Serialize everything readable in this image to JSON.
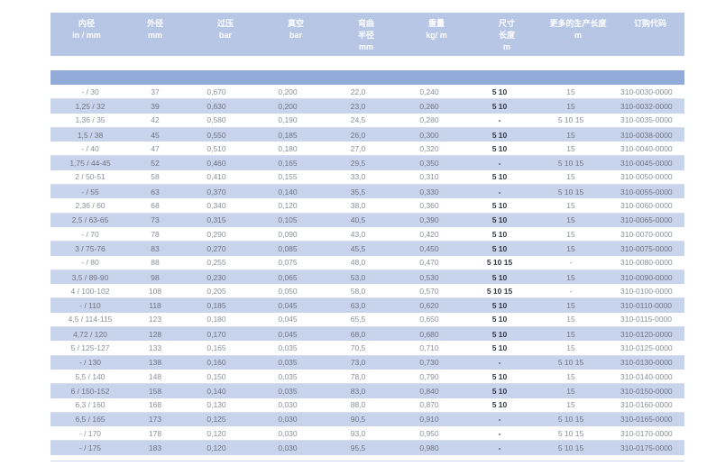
{
  "headers": [
    {
      "l1": "内径",
      "l2": "in / mm",
      "l3": ""
    },
    {
      "l1": "外径",
      "l2": "mm",
      "l3": ""
    },
    {
      "l1": "过压",
      "l2": "bar",
      "l3": ""
    },
    {
      "l1": "真空",
      "l2": "bar",
      "l3": ""
    },
    {
      "l1": "弯曲",
      "l2": "半径",
      "l3": "mm"
    },
    {
      "l1": "重量",
      "l2": "kg/ m",
      "l3": ""
    },
    {
      "l1": "尺寸",
      "l2": "长度",
      "l3": "m"
    },
    {
      "l1": "更多的生产长度",
      "l2": "m",
      "l3": ""
    },
    {
      "l1": "订购代码",
      "l2": "",
      "l3": ""
    }
  ],
  "rows": [
    [
      "- / 30",
      "37",
      "0,670",
      "0,200",
      "22,0",
      "0,240",
      "5 10",
      "15",
      "310-0030-0000"
    ],
    [
      "1,25 / 32",
      "39",
      "0,630",
      "0,200",
      "23,0",
      "0,260",
      "5 10",
      "15",
      "310-0032-0000"
    ],
    [
      "1,36 / 35",
      "42",
      "0,580",
      "0,190",
      "24,5",
      "0,280",
      "-",
      "5 10 15",
      "310-0035-0000"
    ],
    [
      "1,5 / 38",
      "45",
      "0,550",
      "0,185",
      "26,0",
      "0,300",
      "5 10",
      "15",
      "310-0038-0000"
    ],
    [
      "- / 40",
      "47",
      "0,510",
      "0,180",
      "27,0",
      "0,320",
      "5 10",
      "15",
      "310-0040-0000"
    ],
    [
      "1,75 / 44-45",
      "52",
      "0,460",
      "0,165",
      "29,5",
      "0,350",
      "-",
      "5 10 15",
      "310-0045-0000"
    ],
    [
      "2 / 50-51",
      "58",
      "0,410",
      "0,155",
      "33,0",
      "0,310",
      "5 10",
      "15",
      "310-0050-0000"
    ],
    [
      "- / 55",
      "63",
      "0,370",
      "0,140",
      "35,5",
      "0,330",
      "-",
      "5 10 15",
      "310-0055-0000"
    ],
    [
      "2,36 / 60",
      "68",
      "0,340",
      "0,120",
      "38,0",
      "0,360",
      "5 10",
      "15",
      "310-0060-0000"
    ],
    [
      "2,5 / 63-65",
      "73",
      "0,315",
      "0,105",
      "40,5",
      "0,390",
      "5 10",
      "15",
      "310-0065-0000"
    ],
    [
      "- / 70",
      "78",
      "0,290",
      "0,090",
      "43,0",
      "0,420",
      "5 10",
      "15",
      "310-0070-0000"
    ],
    [
      "3 / 75-76",
      "83",
      "0,270",
      "0,085",
      "45,5",
      "0,450",
      "5 10",
      "15",
      "310-0075-0000"
    ],
    [
      "- / 80",
      "88",
      "0,255",
      "0,075",
      "48,0",
      "0,470",
      "5 10 15",
      "-",
      "310-0080-0000"
    ],
    [
      "3,5 / 89-90",
      "98",
      "0,230",
      "0,065",
      "53,0",
      "0,530",
      "5 10",
      "15",
      "310-0090-0000"
    ],
    [
      "4 / 100-102",
      "108",
      "0,205",
      "0,050",
      "58,0",
      "0,570",
      "5 10 15",
      "-",
      "310-0100-0000"
    ],
    [
      "- / 110",
      "118",
      "0,185",
      "0,045",
      "63,0",
      "0,620",
      "5 10",
      "15",
      "310-0110-0000"
    ],
    [
      "4,5 / 114-115",
      "123",
      "0,180",
      "0,045",
      "65,5",
      "0,650",
      "5 10",
      "15",
      "310-0115-0000"
    ],
    [
      "4,72 / 120",
      "128",
      "0,170",
      "0,045",
      "68,0",
      "0,680",
      "5 10",
      "15",
      "310-0120-0000"
    ],
    [
      "5 / 125-127",
      "133",
      "0,165",
      "0,035",
      "70,5",
      "0,710",
      "5 10",
      "15",
      "310-0125-0000"
    ],
    [
      "- / 130",
      "138",
      "0,160",
      "0,035",
      "73,0",
      "0,730",
      "-",
      "5 10 15",
      "310-0130-0000"
    ],
    [
      "5,5 / 140",
      "148",
      "0,150",
      "0,035",
      "78,0",
      "0,790",
      "5 10",
      "15",
      "310-0140-0000"
    ],
    [
      "6 / 150-152",
      "158",
      "0,140",
      "0,035",
      "83,0",
      "0,840",
      "5 10",
      "15",
      "310-0150-0000"
    ],
    [
      "6,3 / 160",
      "168",
      "0,130",
      "0,030",
      "88,0",
      "0,870",
      "5 10",
      "15",
      "310-0160-0000"
    ],
    [
      "6,5 / 165",
      "173",
      "0,125",
      "0,030",
      "90,5",
      "0,910",
      "-",
      "5 10 15",
      "310-0165-0000"
    ],
    [
      "- / 170",
      "178",
      "0,120",
      "0,030",
      "93,0",
      "0,950",
      "-",
      "5 10 15",
      "310-0170-0000"
    ],
    [
      "- / 175",
      "183",
      "0,120",
      "0,030",
      "95,5",
      "0,980",
      "-",
      "5 10 15",
      "310-0175-0000"
    ]
  ]
}
